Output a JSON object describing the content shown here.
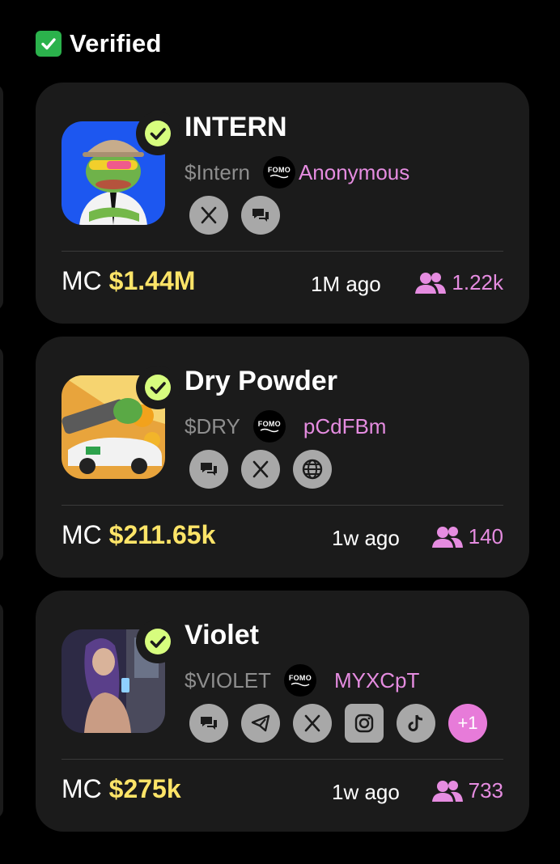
{
  "section": {
    "title": "Verified"
  },
  "colors": {
    "accent_pink": "#e58ce0",
    "mc_yellow": "#fde468",
    "badge_green": "#d7fd7e"
  },
  "tokens": [
    {
      "name": "INTERN",
      "ticker": "$Intern",
      "platform": "FOMO",
      "creator": "Anonymous",
      "links": [
        "x-icon",
        "chat-icon"
      ],
      "mc_label": "MC",
      "mc_value": "$1.44M",
      "age": "1M ago",
      "holders": "1.22k"
    },
    {
      "name": "Dry Powder",
      "ticker": "$DRY",
      "platform": "FOMO",
      "creator": "pCdFBm",
      "links": [
        "chat-icon",
        "x-icon",
        "globe-icon"
      ],
      "mc_label": "MC",
      "mc_value": "$211.65k",
      "age": "1w ago",
      "holders": "140"
    },
    {
      "name": "Violet",
      "ticker": "$VIOLET",
      "platform": "FOMO",
      "creator": "MYXCpT",
      "links": [
        "chat-icon",
        "telegram-icon",
        "x-icon",
        "instagram-icon",
        "tiktok-icon"
      ],
      "more_links": "+1",
      "mc_label": "MC",
      "mc_value": "$275k",
      "age": "1w ago",
      "holders": "733"
    }
  ]
}
